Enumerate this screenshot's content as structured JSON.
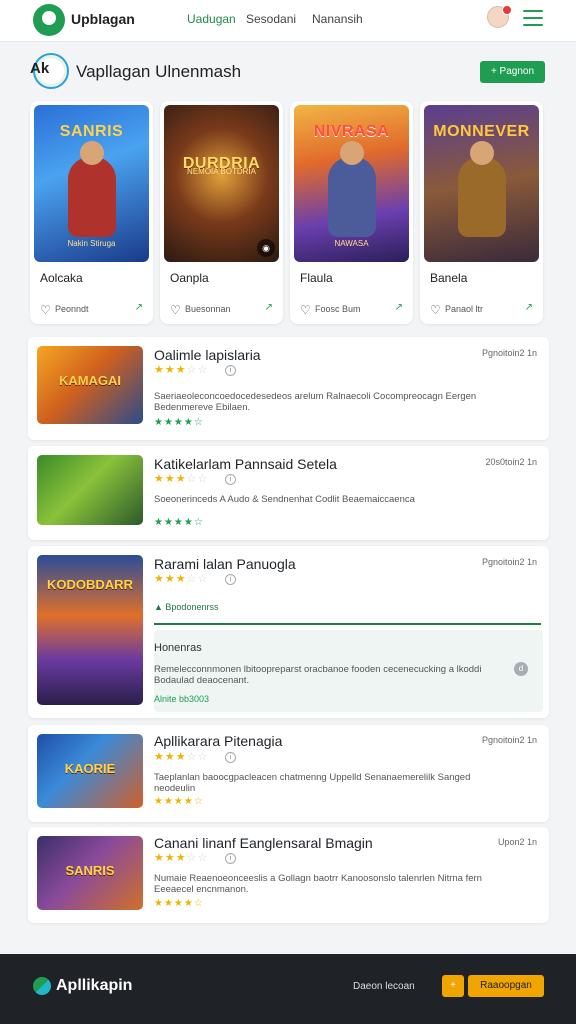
{
  "header": {
    "logo_text": "Upblagan",
    "nav": [
      "Uadugan",
      "Sesodani",
      "Nanansih"
    ]
  },
  "section": {
    "badge_text": "Ak",
    "title": "Vapllagan Ulnenmash",
    "action_label": "+ Pagnon"
  },
  "featured": [
    {
      "art_title": "SANRIS",
      "art_sub": "Nakin Stiruga",
      "name": "Aolcaka",
      "meta": "Peonndt",
      "trend": "↗"
    },
    {
      "art_title": "DURDRIA",
      "art_sub": "NEMOIA BOTDRIA",
      "name": "Oanpla",
      "meta": "Buesonnan",
      "trend": "↗"
    },
    {
      "art_title": "NIVRASA",
      "art_sub": "NAWASA",
      "name": "Flaula",
      "meta": "Foosc Bum",
      "trend": "↗"
    },
    {
      "art_title": "MONNEVER",
      "art_sub": "",
      "name": "Banela",
      "meta": "Panaol ltr",
      "trend": "↗"
    }
  ],
  "list": [
    {
      "title": "Oalimle lapislaria",
      "date": "Pgnoitoin2 1n",
      "stars": 3,
      "desc": "Saeriaeoleconcoedocedesedeos arelum Ralnaecoli Cocompreocagn Eergen Bedenmereve Ebilaen.",
      "thumb_text": "KAMAGAI"
    },
    {
      "title": "Katikelarlam Pannsaid Setela",
      "date": "20s0toin2 1n",
      "stars": 3,
      "desc": "Soeonerinceds A Audo & Sendnenhat Codlit Beaemaiccaenca",
      "thumb_text": ""
    },
    {
      "title": "Rarami lalan Panuogla",
      "date": "Pgnoitoin2 1n",
      "stars": 3,
      "desc": "",
      "thumb_text": "KODOBDARR",
      "subtag": "Bpodonenrss",
      "panel_title": "Honenras",
      "panel_desc": "Remelecconnmonen lbitoopreparst oracbanoe fooden cecenecucking a lkoddi Bodaulad deaocenant.",
      "panel_foot": "Alnite bb3003"
    },
    {
      "title": "Apllikarara Pitenagia",
      "date": "Pgnoitoin2 1n",
      "stars": 3,
      "desc": "Taeplanlan baoocgpacleacen chatmenng Uppelld Senanaemerelilk Sanged neodeulin",
      "thumb_text": "KAORIE"
    },
    {
      "title": "Canani linanf Eanglensaral Bmagin",
      "date": "Upon2 1n",
      "stars": 3,
      "desc": "Numaie Reaenoeonceeslis a Gollagn baotrr Kanoosonslo talenrlen Nitrna fern Eeeaecel encnmanon.",
      "thumb_text": "SANRIS"
    }
  ],
  "footer": {
    "brand": "Apllikapin",
    "link": "Daeon lecoan",
    "icon_label": "+",
    "cta": "Raaoopgan"
  },
  "colors": {
    "accent_green": "#1f9d52",
    "star_gold": "#f0b400",
    "footer_bg": "#1f2328",
    "cta_orange": "#f0a500"
  }
}
